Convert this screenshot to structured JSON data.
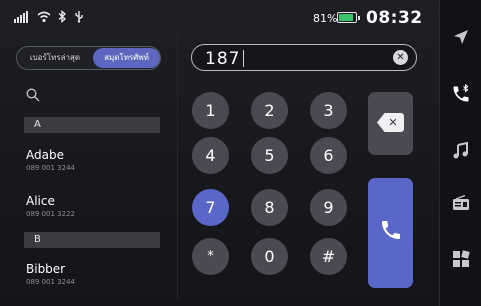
{
  "status": {
    "signal_icon": "signal-bars-icon",
    "wifi_icon": "wifi-icon",
    "bluetooth_icon": "bluetooth-icon",
    "usb_icon": "usb-icon",
    "battery_percent": "81%",
    "battery_level": 0.81,
    "time": "08:32"
  },
  "tabs": {
    "recent_label": "เบอร์โทรล่าสุด",
    "contacts_label": "สมุดโทรศัพท์"
  },
  "contacts": {
    "section_a": "A",
    "section_b": "B",
    "items": [
      {
        "name": "Adabe",
        "phone": "089 001 3244"
      },
      {
        "name": "Alice",
        "phone": "089 001 3222"
      },
      {
        "name": "Bibber",
        "phone": "089 001 3244"
      }
    ]
  },
  "dialer": {
    "entered_number": "187",
    "keys": [
      "1",
      "2",
      "3",
      "4",
      "5",
      "6",
      "7",
      "8",
      "9",
      "*",
      "0",
      "#"
    ],
    "active_key": "7"
  },
  "rail": {
    "items": [
      "navigation-icon",
      "phone-bluetooth-icon",
      "music-icon",
      "radio-icon",
      "apps-icon"
    ]
  },
  "colors": {
    "accent": "#5a66c8",
    "key_bg": "#4a4b52",
    "battery": "#39c36a"
  }
}
